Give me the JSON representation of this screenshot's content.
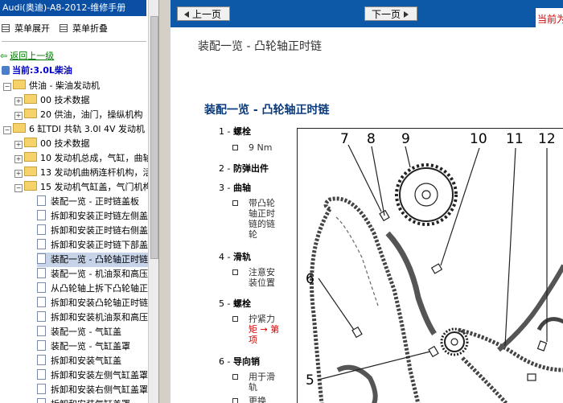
{
  "window_title": "Audi(奥迪)-A8-2012-维修手册",
  "menu": {
    "expand_label": "菜单展开",
    "collapse_label": "菜单折叠"
  },
  "tree": {
    "back_label": "返回上一级",
    "current_label": "当前:3.0L柴油",
    "items": [
      {
        "label": "供油 - 柴油发动机",
        "toggle": "⊟"
      },
      {
        "label": "00 技术数据",
        "toggle": "⊞"
      },
      {
        "label": "20 供油，油门，操纵机构",
        "toggle": "⊞"
      },
      {
        "label": "6 缸TDI 共轨 3.0l 4V 发动机",
        "toggle": "⊟"
      },
      {
        "label": "00 技术数据",
        "toggle": "⊞"
      },
      {
        "label": "10 发动机总成，气缸，曲轴",
        "toggle": "⊞"
      },
      {
        "label": "13 发动机曲柄连杆机构，活",
        "toggle": "⊞"
      },
      {
        "label": "15 发动机气缸盖，气门机构",
        "toggle": "⊟"
      },
      {
        "label": "装配一览 - 正时链盖板"
      },
      {
        "label": "拆卸和安装正时链左侧盖"
      },
      {
        "label": "拆卸和安装正时链右侧盖"
      },
      {
        "label": "拆卸和安装正时链下部盖"
      },
      {
        "label": "装配一览 - 凸轮轴正时链"
      },
      {
        "label": "装配一览 - 机油泵和高压"
      },
      {
        "label": "从凸轮轴上拆下凸轮轴正时"
      },
      {
        "label": "拆卸和安装凸轮轴正时链"
      },
      {
        "label": "拆卸和安装机油泵和高压"
      },
      {
        "label": "装配一览 - 气缸盖"
      },
      {
        "label": "装配一览 - 气缸盖罩"
      },
      {
        "label": "拆卸和安装气缸盖"
      },
      {
        "label": "拆卸和安装左侧气缸盖罩"
      },
      {
        "label": "拆卸和安装右侧气缸盖罩"
      },
      {
        "label": "拆卸和安装气缸盖罩"
      }
    ]
  },
  "nav": {
    "prev_label": "上一页",
    "next_label": "下一页",
    "right_text": "当前为"
  },
  "content": {
    "doc_title": "装配一览 - 凸轮轴正时链",
    "section_title": "装配一览 - 凸轮轴正时链",
    "legend": [
      {
        "num": "1 -",
        "name": "螺栓",
        "sub": [
          "9 Nm"
        ]
      },
      {
        "num": "2 -",
        "name": "防弹出件",
        "sub": []
      },
      {
        "num": "3 -",
        "name": "曲轴",
        "sub": [
          "带凸轮",
          "轴正时",
          "链的链",
          "轮"
        ]
      },
      {
        "num": "4 -",
        "name": "滑轨",
        "sub": [
          "注意安",
          "装位置"
        ]
      },
      {
        "num": "5 -",
        "name": "螺栓",
        "sub": [
          "拧紧力",
          "矩 → 第",
          "项"
        ]
      },
      {
        "num": "6 -",
        "name": "导向销",
        "sub": [
          "用于滑",
          "轨",
          "更换"
        ]
      }
    ]
  },
  "diagram": {
    "labels": [
      "7",
      "8",
      "9",
      "10",
      "11",
      "12",
      "6",
      "5"
    ]
  }
}
